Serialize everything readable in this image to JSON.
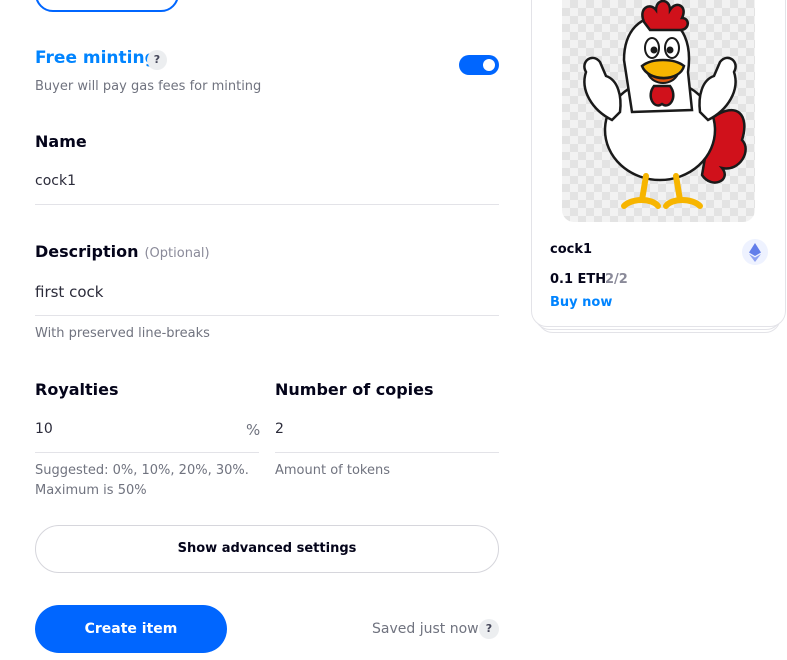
{
  "free_minting": {
    "title": "Free minting",
    "help": "?",
    "subtitle": "Buyer will pay gas fees for minting",
    "enabled": true
  },
  "name": {
    "label": "Name",
    "value": "cock1"
  },
  "description": {
    "label": "Description",
    "optional": "(Optional)",
    "value": "first cock",
    "hint": "With preserved line-breaks"
  },
  "royalties": {
    "label": "Royalties",
    "value": "10",
    "suffix": "%",
    "hint_line1": "Suggested: 0%, 10%, 20%, 30%.",
    "hint_line2": "Maximum is 50%"
  },
  "copies": {
    "label": "Number of copies",
    "value": "2",
    "hint": "Amount of tokens"
  },
  "advanced_button": "Show advanced settings",
  "create_button": "Create item",
  "saved_status": "Saved just now",
  "saved_help": "?",
  "preview": {
    "name": "cock1",
    "price": "0.1 ETH",
    "quantity": "2/2",
    "buy": "Buy now",
    "chain_icon": "ethereum-icon",
    "image": "rooster-thumbs-up-illustration"
  },
  "colors": {
    "accent": "#0066ff",
    "link": "#0084ff",
    "text": "#04041a",
    "muted": "#70737f"
  }
}
